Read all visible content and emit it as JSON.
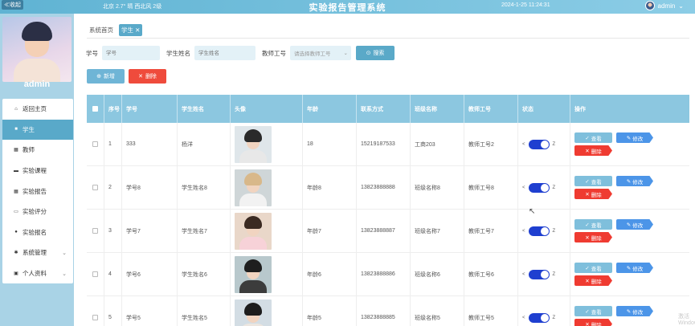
{
  "topbar": {
    "collapse_label": "≪收起",
    "weather": "北京  2.7°  晴  西北风  2级",
    "title": "实验报告管理系统",
    "time": "2024-1-25  11:24:31",
    "user": "admin"
  },
  "sidebar": {
    "username": "admin",
    "items": [
      {
        "label": "返回主页",
        "icon": "home-icon"
      },
      {
        "label": "学生",
        "icon": "user-icon"
      },
      {
        "label": "教师",
        "icon": "grid-icon"
      },
      {
        "label": "实验课程",
        "icon": "book-icon"
      },
      {
        "label": "实验报告",
        "icon": "grid-icon"
      },
      {
        "label": "实验评分",
        "icon": "briefcase-icon"
      },
      {
        "label": "实验报名",
        "icon": "pin-icon"
      },
      {
        "label": "系统管理",
        "icon": "gear-icon"
      },
      {
        "label": "个人资料",
        "icon": "id-card-icon"
      }
    ]
  },
  "tabs": {
    "home": "系统首页",
    "current": "学生 ✕"
  },
  "search": {
    "student_no_label": "学号",
    "student_no_placeholder": "学号",
    "student_name_label": "学生姓名",
    "student_name_placeholder": "学生姓名",
    "teacher_no_label": "教师工号",
    "teacher_no_placeholder": "请选择教师工号",
    "search_button": "搜索"
  },
  "actions": {
    "add": "新增",
    "delete": "删除"
  },
  "table": {
    "headers": [
      "序号",
      "学号",
      "学生姓名",
      "头像",
      "年龄",
      "联系方式",
      "班级名称",
      "教师工号",
      "状态",
      "操作"
    ],
    "rows": [
      {
        "idx": "1",
        "no": "333",
        "name": "杨洋",
        "age": "18",
        "phone": "15219187533",
        "cls": "工商203",
        "teacher": "教师工号2"
      },
      {
        "idx": "2",
        "no": "学号8",
        "name": "学生姓名8",
        "age": "年龄8",
        "phone": "13823888888",
        "cls": "班级名称8",
        "teacher": "教师工号8"
      },
      {
        "idx": "3",
        "no": "学号7",
        "name": "学生姓名7",
        "age": "年龄7",
        "phone": "13823888887",
        "cls": "班级名称7",
        "teacher": "教师工号7"
      },
      {
        "idx": "4",
        "no": "学号6",
        "name": "学生姓名6",
        "age": "年龄6",
        "phone": "13823888886",
        "cls": "班级名称6",
        "teacher": "教师工号6"
      },
      {
        "idx": "5",
        "no": "学号5",
        "name": "学生姓名5",
        "age": "年龄5",
        "phone": "13823888885",
        "cls": "班级名称5",
        "teacher": "教师工号5"
      }
    ],
    "op_view": "查看",
    "op_edit": "修改",
    "op_delete": "删除"
  },
  "watermark": "激活 Windows"
}
